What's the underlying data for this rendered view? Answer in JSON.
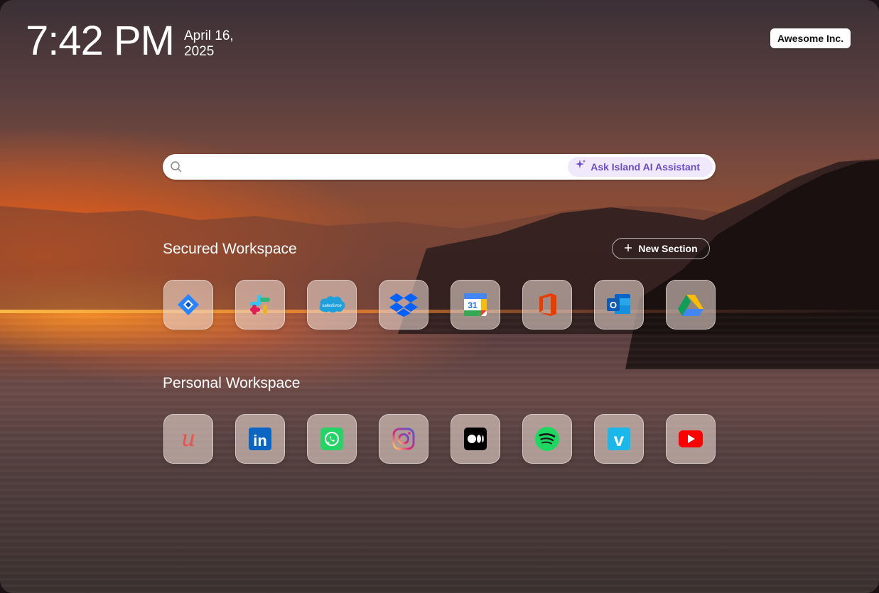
{
  "clock": {
    "time": "7:42 PM",
    "date_line1": "April 16,",
    "date_line2": "2025"
  },
  "org": {
    "name": "Awesome Inc."
  },
  "search": {
    "placeholder": "",
    "ai_button_label": "Ask Island AI Assistant"
  },
  "secured": {
    "title": "Secured Workspace",
    "new_section_label": "New Section",
    "apps": [
      {
        "icon": "jira-icon"
      },
      {
        "icon": "slack-icon"
      },
      {
        "icon": "salesforce-icon",
        "label": "salesforce"
      },
      {
        "icon": "dropbox-icon"
      },
      {
        "icon": "google-calendar-icon",
        "label": "31"
      },
      {
        "icon": "microsoft-office-icon"
      },
      {
        "icon": "outlook-icon",
        "label": "O"
      },
      {
        "icon": "google-drive-icon"
      }
    ]
  },
  "personal": {
    "title": "Personal Workspace",
    "apps": [
      {
        "icon": "udemy-icon",
        "label": "u"
      },
      {
        "icon": "linkedin-icon",
        "label": "in"
      },
      {
        "icon": "whatsapp-icon"
      },
      {
        "icon": "instagram-icon"
      },
      {
        "icon": "medium-icon"
      },
      {
        "icon": "spotify-icon"
      },
      {
        "icon": "vimeo-icon",
        "label": "v"
      },
      {
        "icon": "youtube-icon"
      }
    ]
  },
  "colors": {
    "accent": "#6a4bc8",
    "ai_button_bg": "#efe9fb"
  }
}
